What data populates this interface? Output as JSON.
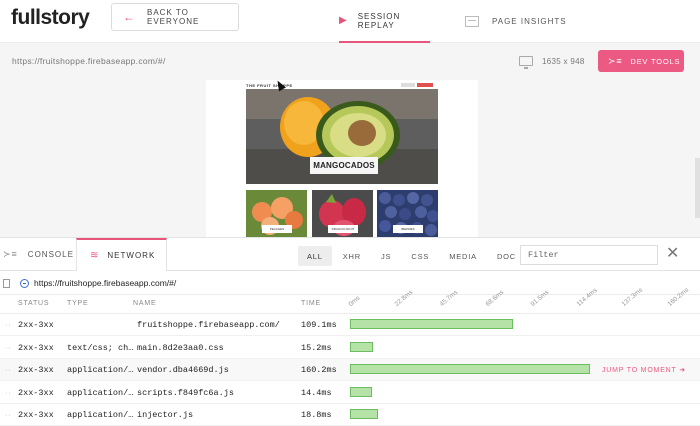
{
  "header": {
    "logo": "fullstory",
    "back_label": "BACK TO EVERYONE",
    "tabs": [
      {
        "label": "SESSION REPLAY",
        "active": true,
        "icon": "play-icon"
      },
      {
        "label": "PAGE INSIGHTS",
        "active": false,
        "icon": "page-insights-icon"
      }
    ]
  },
  "urlbar": {
    "url": "https://fruitshoppe.firebaseapp.com/#/",
    "resolution": "1635 x 948",
    "devtools_label": "DEV TOOLS"
  },
  "replay": {
    "site_title": "THE FRUIT SHOPPE",
    "hero_label": "MANGOCADOS",
    "thumbs": [
      "PEACHES",
      "DRAGON FRUIT",
      "BERRIES"
    ]
  },
  "devtools": {
    "tabs": [
      {
        "label": "CONSOLE",
        "active": false
      },
      {
        "label": "NETWORK",
        "active": true
      }
    ],
    "filters": [
      "ALL",
      "XHR",
      "JS",
      "CSS",
      "MEDIA",
      "DOC"
    ],
    "active_filter": "ALL",
    "filter_placeholder": "Filter",
    "document_url": "https://fruitshoppe.firebaseapp.com/#/",
    "columns": {
      "status": "STATUS",
      "type": "TYPE",
      "name": "NAME",
      "time": "TIME"
    },
    "timeline_ticks": [
      "0ms",
      "22.8ms",
      "45.7ms",
      "68.6ms",
      "91.5ms",
      "114.4ms",
      "137.3ms",
      "160.2ms"
    ],
    "jump_label": "JUMP TO MOMENT",
    "rows": [
      {
        "status": "2xx-3xx",
        "type": "",
        "name": "fruitshoppe.firebaseapp.com/",
        "time": "109.1ms",
        "start": 0,
        "duration": 109.1
      },
      {
        "status": "2xx-3xx",
        "type": "text/css; ch…",
        "name": "main.8d2e3aa0.css",
        "time": "15.2ms",
        "start": 0,
        "duration": 15.2
      },
      {
        "status": "2xx-3xx",
        "type": "application/…",
        "name": "vendor.dba4669d.js",
        "time": "160.2ms",
        "start": 0,
        "duration": 160.2
      },
      {
        "status": "2xx-3xx",
        "type": "application/…",
        "name": "scripts.f849fc6a.js",
        "time": "14.4ms",
        "start": 0,
        "duration": 14.4
      },
      {
        "status": "2xx-3xx",
        "type": "application/…",
        "name": "injector.js",
        "time": "18.8ms",
        "start": 0,
        "duration": 18.8
      }
    ]
  }
}
